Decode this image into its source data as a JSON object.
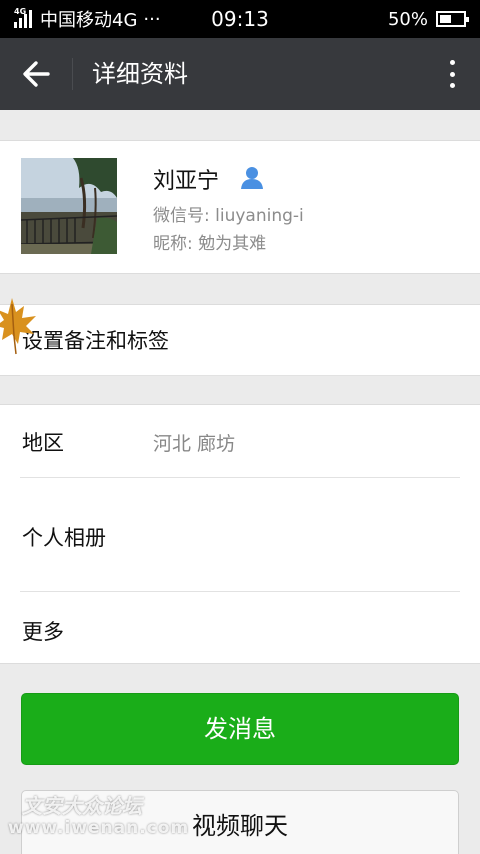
{
  "status_bar": {
    "network_type": "4G",
    "carrier": "中国移动4G",
    "more": "···",
    "time": "09:13",
    "battery": "50%",
    "battery_level": 0.5
  },
  "title_bar": {
    "title": "详细资料",
    "back_icon": "arrow-left-icon",
    "menu_icon": "more-vertical-icon"
  },
  "profile": {
    "name": "刘亚宁",
    "wechat_id": "微信号: liuyaning-i",
    "nickname": "昵称: 勉为其难",
    "badge_icon": "person-icon",
    "badge_color": "#4a90e2"
  },
  "remark": {
    "label": "设置备注和标签"
  },
  "info": {
    "region_label": "地区",
    "region_value": "河北  廊坊",
    "album_label": "个人相册",
    "more_label": "更多"
  },
  "actions": {
    "send_message": "发消息",
    "video_chat": "视频聊天",
    "primary_color": "#1aad19"
  },
  "watermark": {
    "cn": "文安大众论坛",
    "en": "www.iwenan.com"
  }
}
